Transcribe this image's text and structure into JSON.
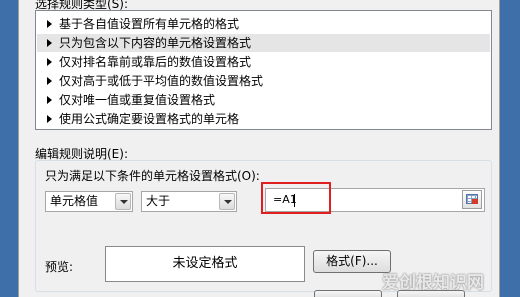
{
  "rule_type": {
    "label": "选择规则类型(S):",
    "items": [
      {
        "label": "基于各自值设置所有单元格的格式"
      },
      {
        "label": "只为包含以下内容的单元格设置格式"
      },
      {
        "label": "仅对排名靠前或靠后的数值设置格式"
      },
      {
        "label": "仅对高于或低于平均值的数值设置格式"
      },
      {
        "label": "仅对唯一值或重复值设置格式"
      },
      {
        "label": "使用公式确定要设置格式的单元格"
      }
    ],
    "selected_index": 1
  },
  "edit_rule": {
    "label": "编辑规则说明(E):",
    "condition_label": "只为满足以下条件的单元格设置格式(O):",
    "field_combo": "单元格值",
    "operator_combo": "大于",
    "value_input": "=A1",
    "preview_label": "预览:",
    "preview_text": "未设定格式",
    "format_button": "格式(F)..."
  },
  "watermark": "爱创根知识网",
  "colors": {
    "selection": "#e5e5e5",
    "highlight_border": "#e02020",
    "backdrop": "#3f6fa8"
  }
}
